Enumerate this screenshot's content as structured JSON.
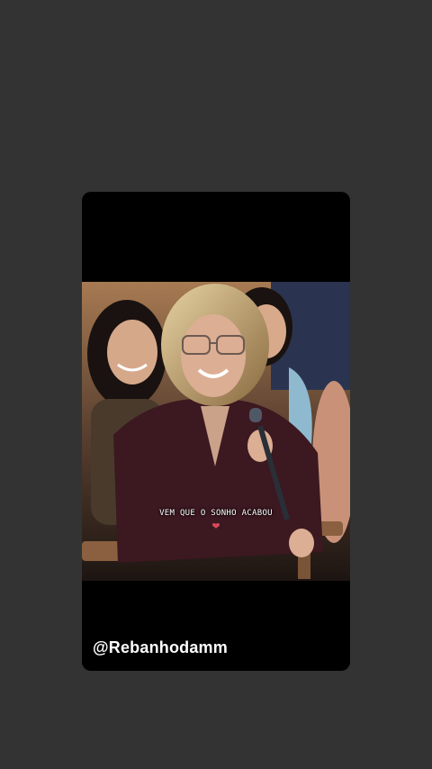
{
  "story": {
    "caption": "VEM QUE O SONHO ACABOU",
    "username": "@Rebanhodamm"
  },
  "icons": {
    "heart": "heart-emoji"
  },
  "colors": {
    "background": "#333333",
    "card": "#000000",
    "heart": "#d94a5a"
  }
}
